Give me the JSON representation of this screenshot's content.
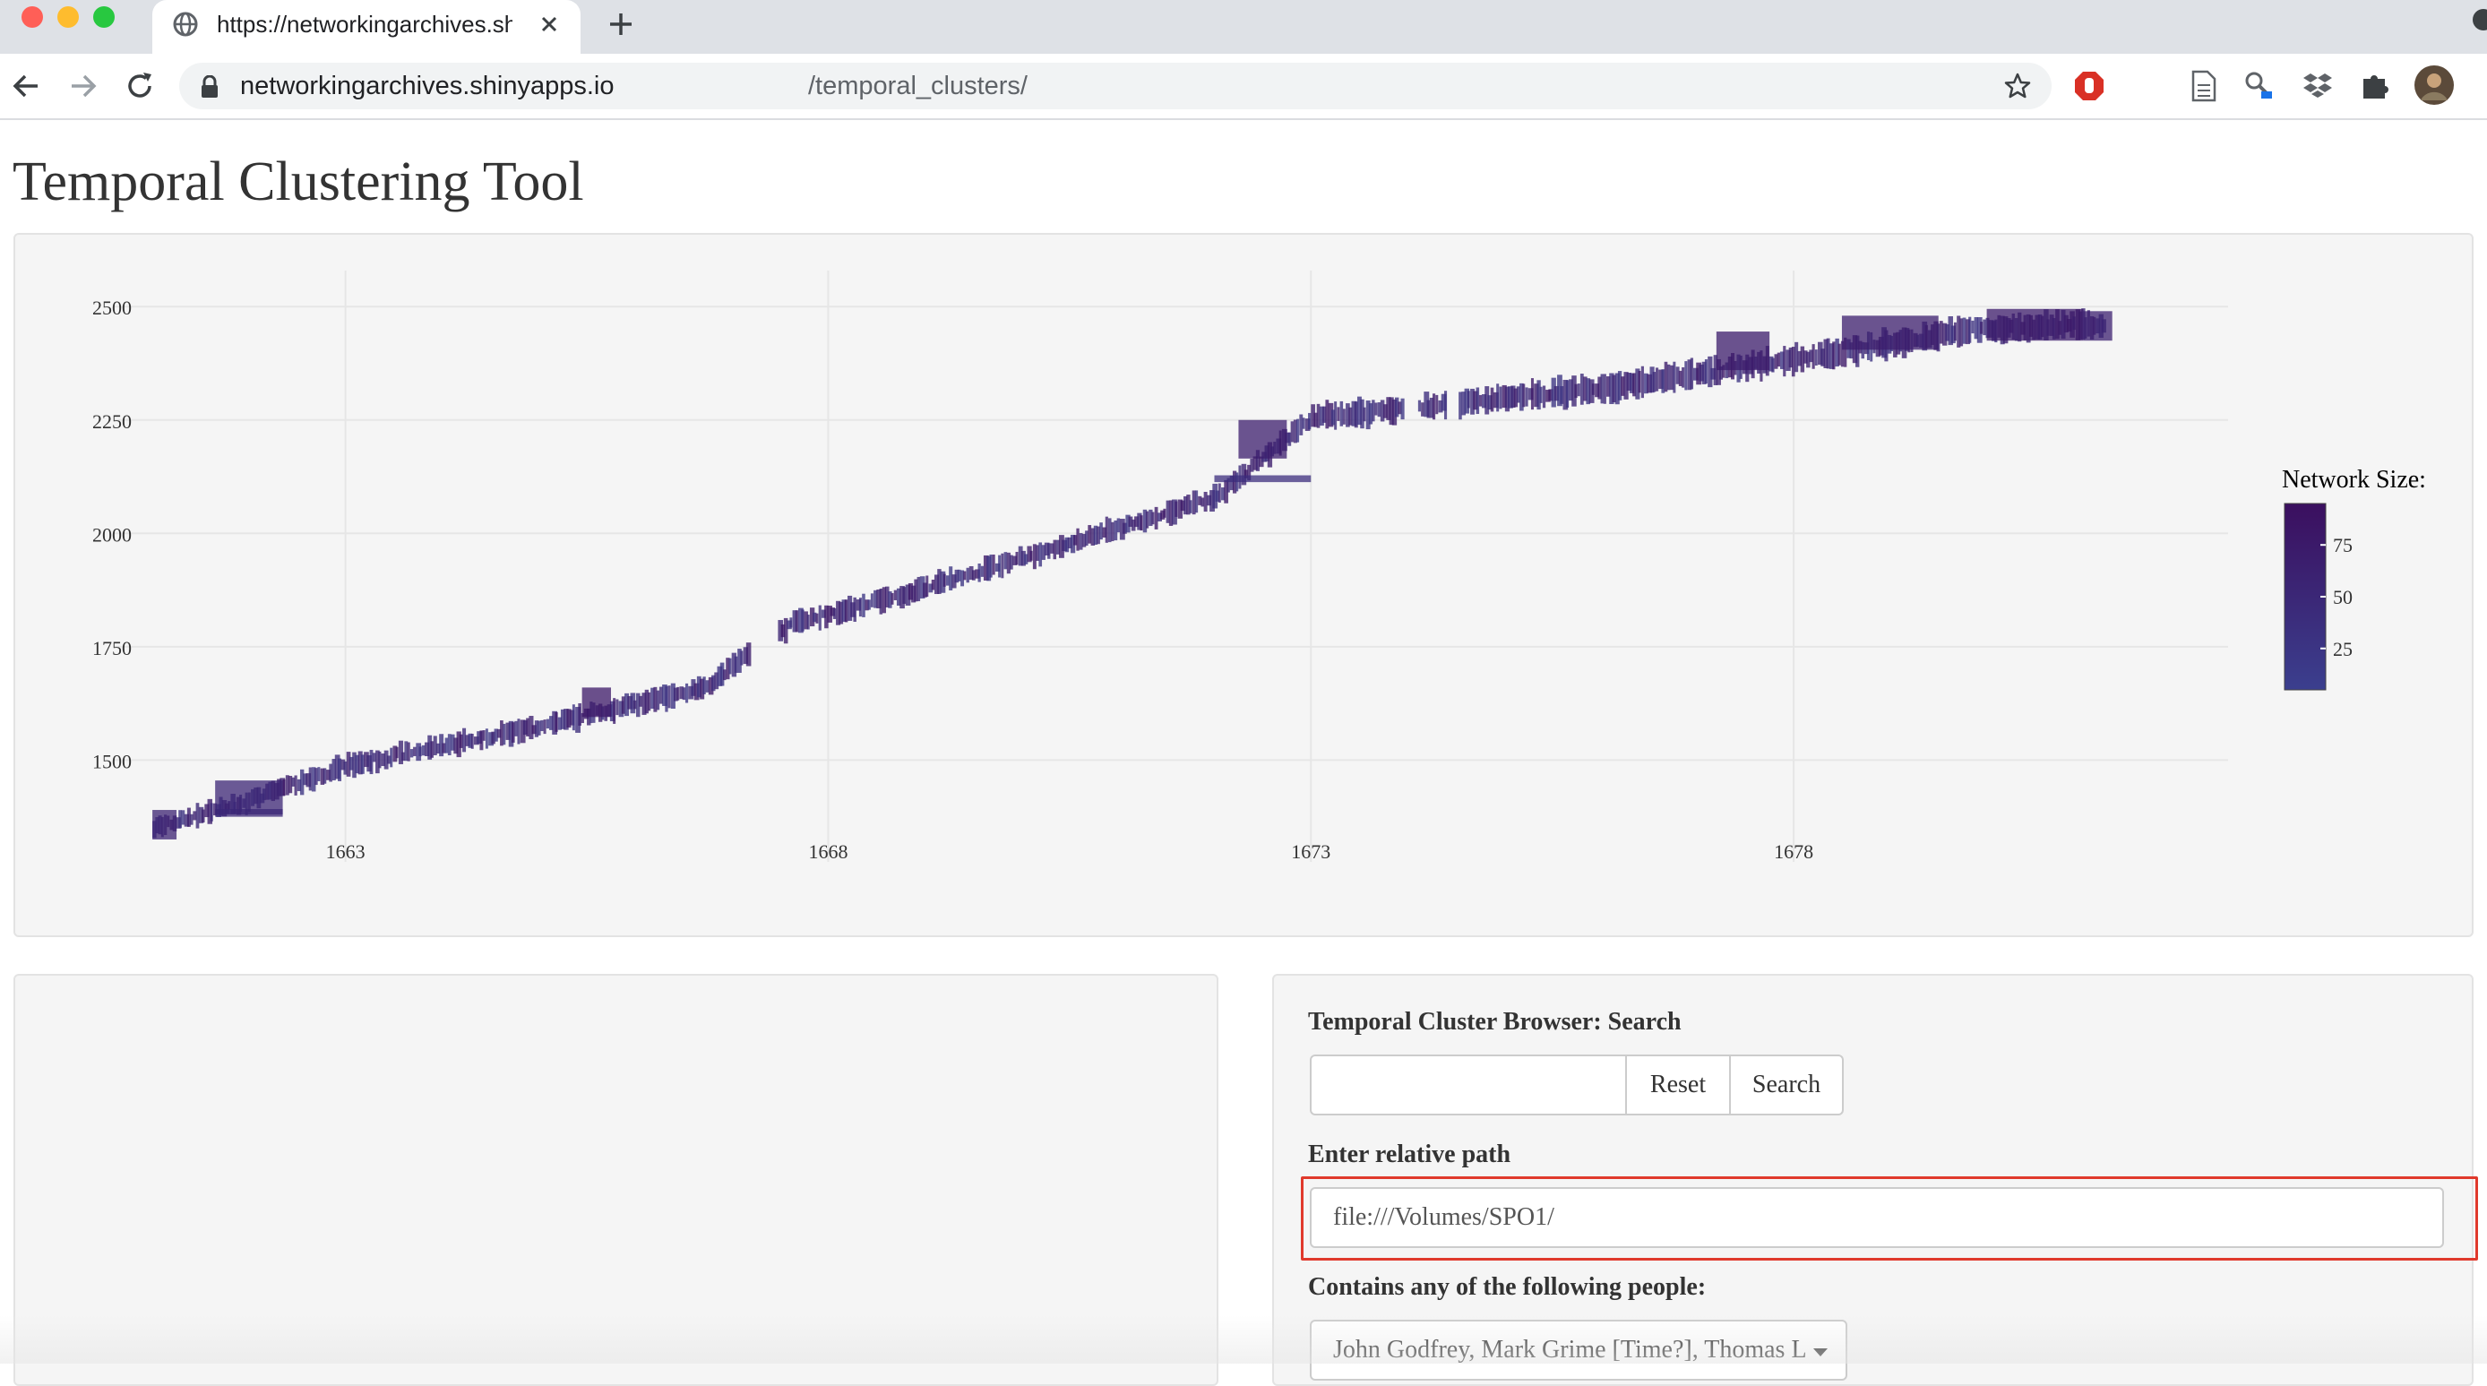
{
  "browser": {
    "tab_title": "https://networkingarchives.shinyapps.io/temporal_clusters/",
    "url_host": "networkingarchives.shinyapps.io",
    "url_path": "/temporal_clusters/",
    "colors": {
      "close": "#ff5f57",
      "minimize": "#febc2e",
      "zoom": "#28c840",
      "stop_extension": "#d93025"
    }
  },
  "page": {
    "title": "Temporal Clustering Tool"
  },
  "chart_data": {
    "type": "scatter",
    "x_ticks": [
      1663,
      1668,
      1673,
      1678
    ],
    "y_ticks": [
      1500,
      1750,
      2000,
      2250,
      2500
    ],
    "xlim": [
      1660.6,
      1682.5
    ],
    "ylim": [
      1315,
      2540
    ],
    "grid": true,
    "legend": {
      "title": "Network Size:",
      "placement": "right",
      "ticks": [
        75,
        50,
        25
      ],
      "range": [
        5,
        95
      ],
      "color_low": "#3b3f8e",
      "color_high": "#3b0f5f"
    },
    "anchors": [
      {
        "x": 1661.0,
        "y": 1350
      },
      {
        "x": 1661.9,
        "y": 1405
      },
      {
        "x": 1663.0,
        "y": 1488
      },
      {
        "x": 1665.0,
        "y": 1575
      },
      {
        "x": 1666.7,
        "y": 1660
      },
      {
        "x": 1667.6,
        "y": 1800
      },
      {
        "x": 1669.0,
        "y": 1880
      },
      {
        "x": 1672.0,
        "y": 2080
      },
      {
        "x": 1673.0,
        "y": 2255
      },
      {
        "x": 1674.2,
        "y": 2280
      },
      {
        "x": 1676.0,
        "y": 2320
      },
      {
        "x": 1678.5,
        "y": 2400
      },
      {
        "x": 1679.8,
        "y": 2450
      },
      {
        "x": 1681.2,
        "y": 2460
      }
    ],
    "gaps": [
      [
        1667.15,
        1667.45
      ],
      [
        1673.95,
        1674.08
      ],
      [
        1674.4,
        1674.52
      ]
    ],
    "blocks": [
      {
        "x0": 1661.0,
        "x1": 1661.25,
        "y0": 1325,
        "y1": 1390,
        "size": 60
      },
      {
        "x0": 1661.65,
        "x1": 1662.35,
        "y0": 1380,
        "y1": 1455,
        "size": 55
      },
      {
        "x0": 1661.65,
        "x1": 1662.35,
        "y0": 1375,
        "y1": 1392,
        "size": 50
      },
      {
        "x0": 1665.45,
        "x1": 1665.75,
        "y0": 1595,
        "y1": 1660,
        "size": 80
      },
      {
        "x0": 1672.25,
        "x1": 1672.75,
        "y0": 2165,
        "y1": 2250,
        "size": 70
      },
      {
        "x0": 1672.0,
        "x1": 1673.0,
        "y0": 2113,
        "y1": 2128,
        "size": 40
      },
      {
        "x0": 1677.2,
        "x1": 1677.75,
        "y0": 2360,
        "y1": 2445,
        "size": 72
      },
      {
        "x0": 1678.5,
        "x1": 1679.5,
        "y0": 2405,
        "y1": 2480,
        "size": 70
      },
      {
        "x0": 1680.0,
        "x1": 1681.0,
        "y0": 2425,
        "y1": 2495,
        "size": 75
      },
      {
        "x0": 1681.0,
        "x1": 1681.3,
        "y0": 2425,
        "y1": 2490,
        "size": 65
      }
    ]
  },
  "controls": {
    "search_label": "Temporal Cluster Browser: Search",
    "search_value": "",
    "reset_label": "Reset",
    "search_button_label": "Search",
    "path_label": "Enter relative path",
    "path_value": "file:///Volumes/SPO1/",
    "people_label": "Contains any of the following people:",
    "people_value": "John Godfrey, Mark Grime [Time?], Thomas L"
  }
}
